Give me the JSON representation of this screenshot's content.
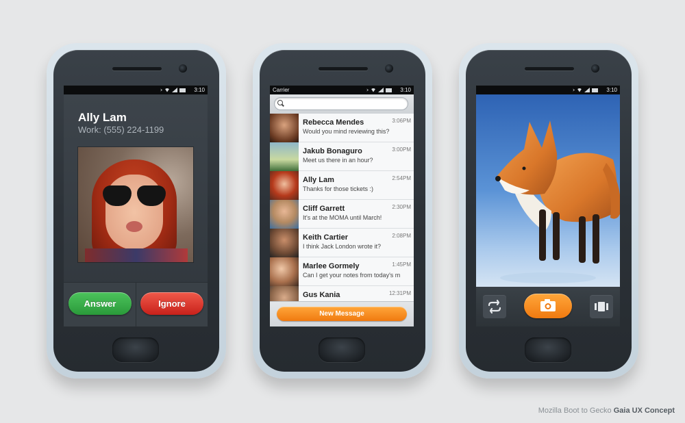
{
  "status_bar": {
    "time": "3:10",
    "carrier": "Carrier"
  },
  "call": {
    "caller_name": "Ally Lam",
    "caller_label": "Work:",
    "caller_number": "(555) 224-1199",
    "answer_label": "Answer",
    "ignore_label": "Ignore"
  },
  "messages": {
    "search_placeholder": "",
    "items": [
      {
        "name": "Rebecca Mendes",
        "preview": "Would you mind reviewing this?",
        "time": "3:06PM"
      },
      {
        "name": "Jakub Bonaguro",
        "preview": "Meet us there in an hour?",
        "time": "3:00PM"
      },
      {
        "name": "Ally Lam",
        "preview": "Thanks for those tickets :)",
        "time": "2:54PM"
      },
      {
        "name": "Cliff Garrett",
        "preview": "It's at the MOMA until March!",
        "time": "2:30PM"
      },
      {
        "name": "Keith Cartier",
        "preview": "I think Jack London wrote it?",
        "time": "2:08PM"
      },
      {
        "name": "Marlee Gormely",
        "preview": "Can I get your notes from today's m",
        "time": "1:45PM"
      },
      {
        "name": "Gus Kania",
        "preview": "",
        "time": "12:31PM"
      }
    ],
    "new_message_label": "New Message"
  },
  "camera": {
    "icons": {
      "switch": "switch-camera-icon",
      "shutter": "camera-icon",
      "mode": "video-mode-icon"
    }
  },
  "caption": {
    "prefix": "Mozilla Boot to Gecko",
    "emphasis": "Gaia UX Concept"
  },
  "colors": {
    "answer": "#2fa63f",
    "ignore": "#d9302a",
    "accent_orange": "#f7891f",
    "background": "#e6e7e8"
  }
}
